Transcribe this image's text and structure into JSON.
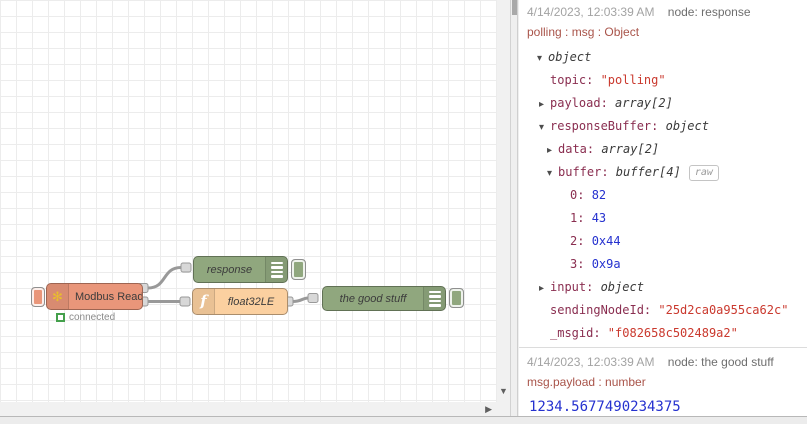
{
  "canvas": {
    "nodes": {
      "modbus": {
        "label": "Modbus Read",
        "status": "connected",
        "color": "#e9967a",
        "icon": "modbus-flower"
      },
      "response": {
        "label": "response",
        "color": "#90a77e",
        "icon": "debug-list"
      },
      "func": {
        "label": "float32LE",
        "color": "#fbd0a0",
        "icon": "function-f",
        "icon_glyph": "f"
      },
      "good": {
        "label": "the good stuff",
        "color": "#90a77e",
        "icon": "debug-list"
      }
    },
    "wire_color": "#999999",
    "modbus_icon_glyph": "✻"
  },
  "debug": {
    "messages": [
      {
        "timestamp": "4/14/2023, 12:03:39 AM",
        "node_label": "node: response",
        "meta": "polling : msg : Object",
        "tree": [
          {
            "level": 0,
            "arrow": "down",
            "key": "",
            "value": "object",
            "type": "type"
          },
          {
            "level": 1,
            "arrow": null,
            "key": "topic",
            "value": "\"polling\"",
            "type": "string"
          },
          {
            "level": 1,
            "arrow": "right",
            "key": "payload",
            "value": "array[2]",
            "type": "type"
          },
          {
            "level": 1,
            "arrow": "down",
            "key": "responseBuffer",
            "value": "object",
            "type": "type"
          },
          {
            "level": 2,
            "arrow": "right",
            "key": "data",
            "value": "array[2]",
            "type": "type"
          },
          {
            "level": 2,
            "arrow": "down",
            "key": "buffer",
            "value": "buffer[4]",
            "type": "type",
            "raw": true
          },
          {
            "level": 3,
            "arrow": null,
            "key": "0",
            "value": "82",
            "type": "number"
          },
          {
            "level": 3,
            "arrow": null,
            "key": "1",
            "value": "43",
            "type": "number"
          },
          {
            "level": 3,
            "arrow": null,
            "key": "2",
            "value": "0x44",
            "type": "number"
          },
          {
            "level": 3,
            "arrow": null,
            "key": "3",
            "value": "0x9a",
            "type": "number"
          },
          {
            "level": 1,
            "arrow": "right",
            "key": "input",
            "value": "object",
            "type": "type"
          },
          {
            "level": 1,
            "arrow": null,
            "key": "sendingNodeId",
            "value": "\"25d2ca0a955ca62c\"",
            "type": "string"
          },
          {
            "level": 1,
            "arrow": null,
            "key": "_msgid",
            "value": "\"f082658c502489a2\"",
            "type": "string"
          }
        ]
      },
      {
        "timestamp": "4/14/2023, 12:03:39 AM",
        "node_label": "node: the good stuff",
        "meta": "msg.payload : number",
        "value": "1234.5677490234375"
      }
    ],
    "raw_button": "raw",
    "colors": {
      "key": "#8a2e50",
      "string": "#ca392e",
      "number": "#2531cf",
      "meta": "#a9544a",
      "timestamp": "#a3a3a3"
    }
  }
}
